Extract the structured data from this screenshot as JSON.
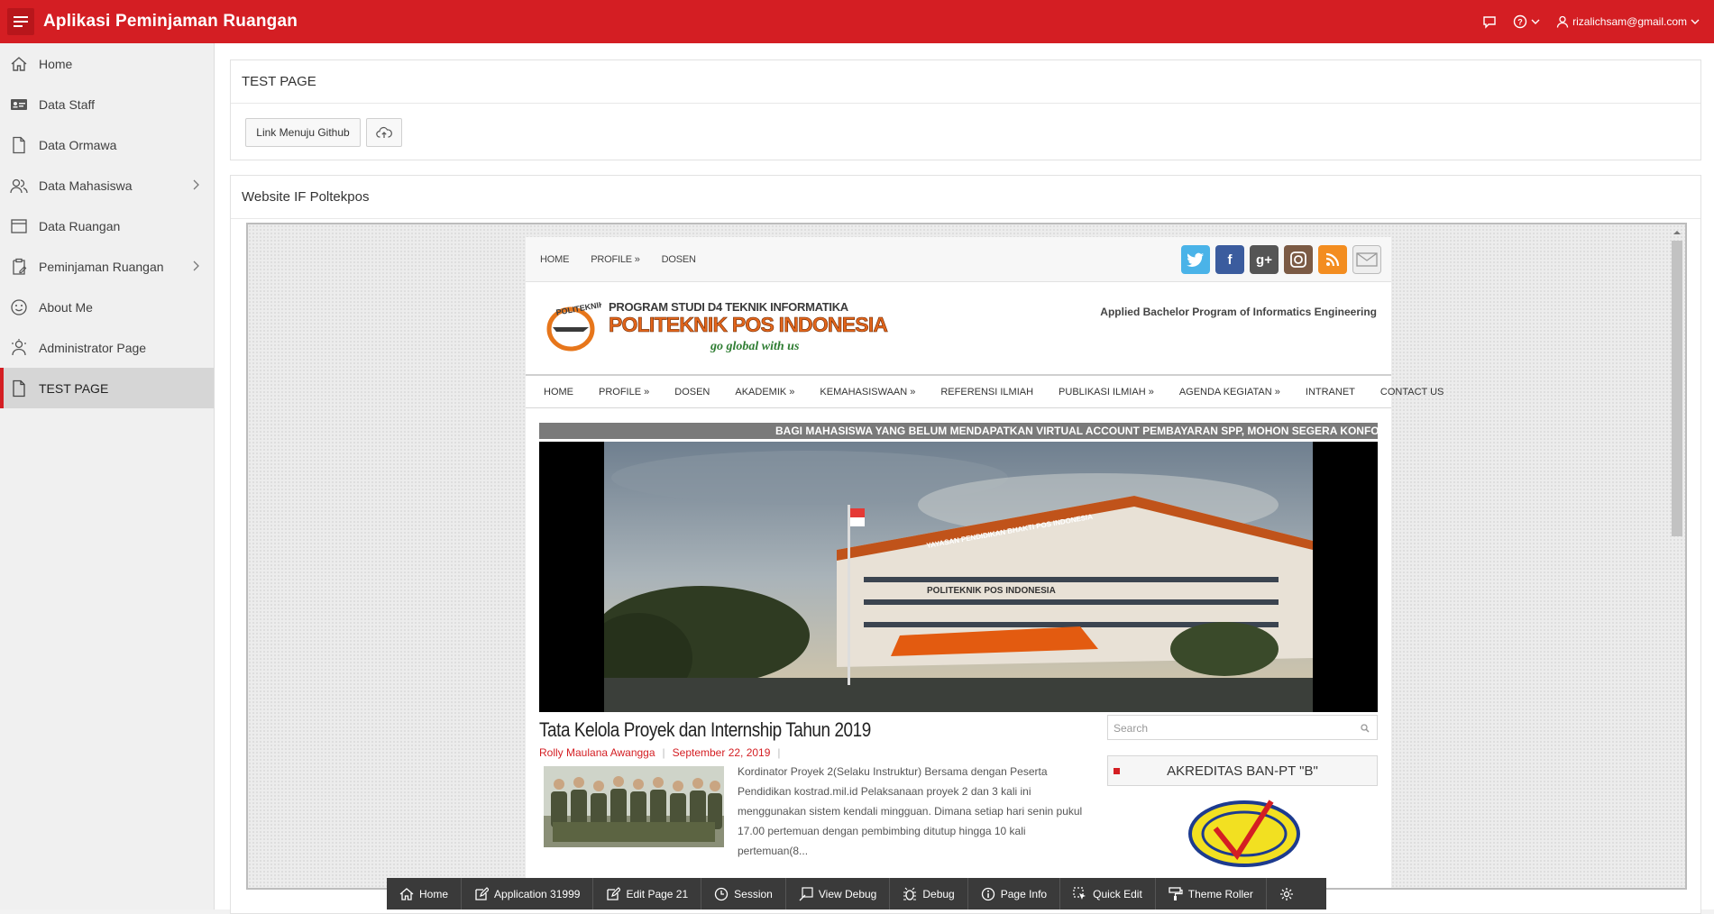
{
  "app": {
    "title": "Aplikasi Peminjaman Ruangan",
    "user_email": "rizalichsam@gmail.com"
  },
  "sidebar": {
    "items": [
      {
        "label": "Home",
        "icon": "home-icon",
        "has_submenu": false
      },
      {
        "label": "Data Staff",
        "icon": "id-card-icon",
        "has_submenu": false
      },
      {
        "label": "Data Ormawa",
        "icon": "file-icon",
        "has_submenu": false
      },
      {
        "label": "Data Mahasiswa",
        "icon": "users-icon",
        "has_submenu": true
      },
      {
        "label": "Data Ruangan",
        "icon": "window-icon",
        "has_submenu": false
      },
      {
        "label": "Peminjaman Ruangan",
        "icon": "clipboard-icon",
        "has_submenu": true
      },
      {
        "label": "About Me",
        "icon": "smile-icon",
        "has_submenu": false
      },
      {
        "label": "Administrator Page",
        "icon": "user-gear-icon",
        "has_submenu": false
      },
      {
        "label": "TEST PAGE",
        "icon": "file-icon",
        "has_submenu": false,
        "active": true
      }
    ]
  },
  "regions": {
    "test_page": {
      "title": "TEST PAGE",
      "github_button": "Link Menuju Github"
    },
    "website": {
      "title": "Website IF Poltekpos"
    }
  },
  "site": {
    "top_nav": [
      "HOME",
      "PROFILE »",
      "DOSEN"
    ],
    "logo_line1": "PROGRAM STUDI D4 TEKNIK INFORMATIKA",
    "logo_line2": "POLITEKNIK POS INDONESIA",
    "logo_line3": "go global with us",
    "logo_badge": "POLITEKNIK",
    "tagline": "Applied Bachelor Program of Informatics Engineering",
    "main_nav": [
      "HOME",
      "PROFILE »",
      "DOSEN",
      "AKADEMIK »",
      "KEMAHASISWAAN »",
      "REFERENSI ILMIAH",
      "PUBLIKASI ILMIAH »",
      "AGENDA KEGIATAN »",
      "INTRANET",
      "CONTACT US"
    ],
    "ticker": "BAGI MAHASISWA YANG BELUM MENDAPATKAN VIRTUAL ACCOUNT PEMBAYARAN SPP, MOHON SEGERA KONFO",
    "building_sign": "YAYASAN PENDIDIKAN BHAKTI POS INDONESIA",
    "building_name": "POLITEKNIK POS INDONESIA",
    "post": {
      "title": "Tata Kelola Proyek dan Internship Tahun 2019",
      "author": "Rolly Maulana Awangga",
      "date": "September 22, 2019",
      "excerpt": "Kordinator Proyek 2(Selaku Instruktur) Bersama dengan Peserta Pendidikan kostrad.mil.id  Pelaksanaan proyek 2 dan 3 kali ini menggunakan sistem kendali mingguan. Dimana setiap hari senin pukul 17.00 pertemuan dengan pembimbing ditutup hingga 10 kali pertemuan(8..."
    },
    "search_placeholder": "Search",
    "widget_title": "AKREDITAS BAN-PT \"B\""
  },
  "devbar": [
    "Home",
    "Application 31999",
    "Edit Page 21",
    "Session",
    "View Debug",
    "Debug",
    "Page Info",
    "Quick Edit",
    "Theme Roller"
  ],
  "colors": {
    "brand": "#d41e23",
    "devbar": "#3a3a3a",
    "sidebar": "#f0f0f0"
  }
}
